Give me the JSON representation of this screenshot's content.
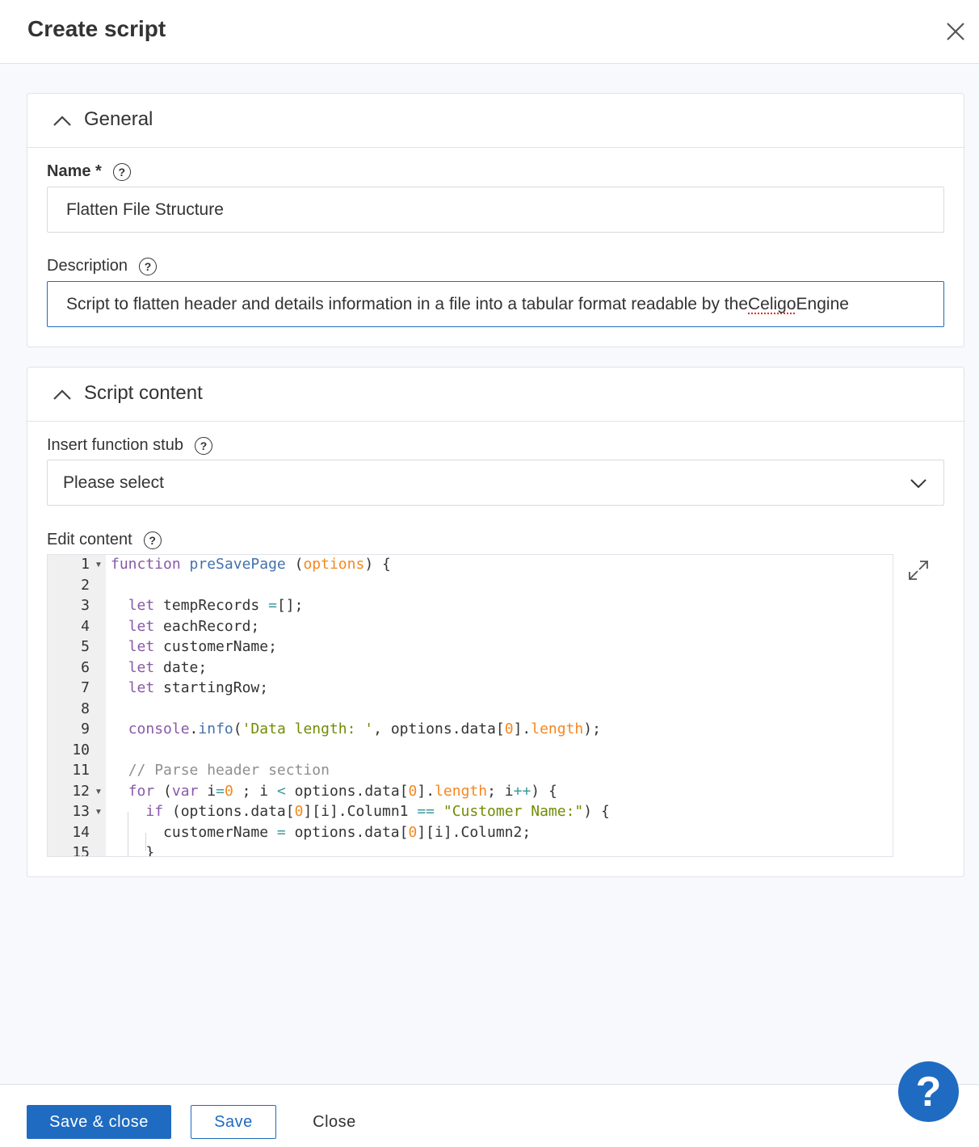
{
  "header": {
    "title": "Create script"
  },
  "general": {
    "title": "General",
    "name_label": "Name *",
    "name_value": "Flatten File Structure",
    "description_label": "Description",
    "description_pre": "Script to flatten header and details information in a file into a tabular format readable by the ",
    "description_mark": "Celigo",
    "description_post": " Engine"
  },
  "script": {
    "title": "Script content",
    "stub_label": "Insert function stub",
    "stub_value": "Please select",
    "edit_label": "Edit content",
    "line_numbers": [
      "1",
      "2",
      "3",
      "4",
      "5",
      "6",
      "7",
      "8",
      "9",
      "10",
      "11",
      "12",
      "13",
      "14",
      "15"
    ]
  },
  "footer": {
    "save_close": "Save & close",
    "save": "Save",
    "close": "Close"
  },
  "icons": {
    "close": "close-icon",
    "chevron": "chevron-up-icon",
    "help": "help-icon",
    "dropdown": "chevron-down-icon",
    "expand": "expand-icon",
    "help_fab": "help-fab-icon"
  },
  "colors": {
    "primary": "#1f6bc1"
  }
}
